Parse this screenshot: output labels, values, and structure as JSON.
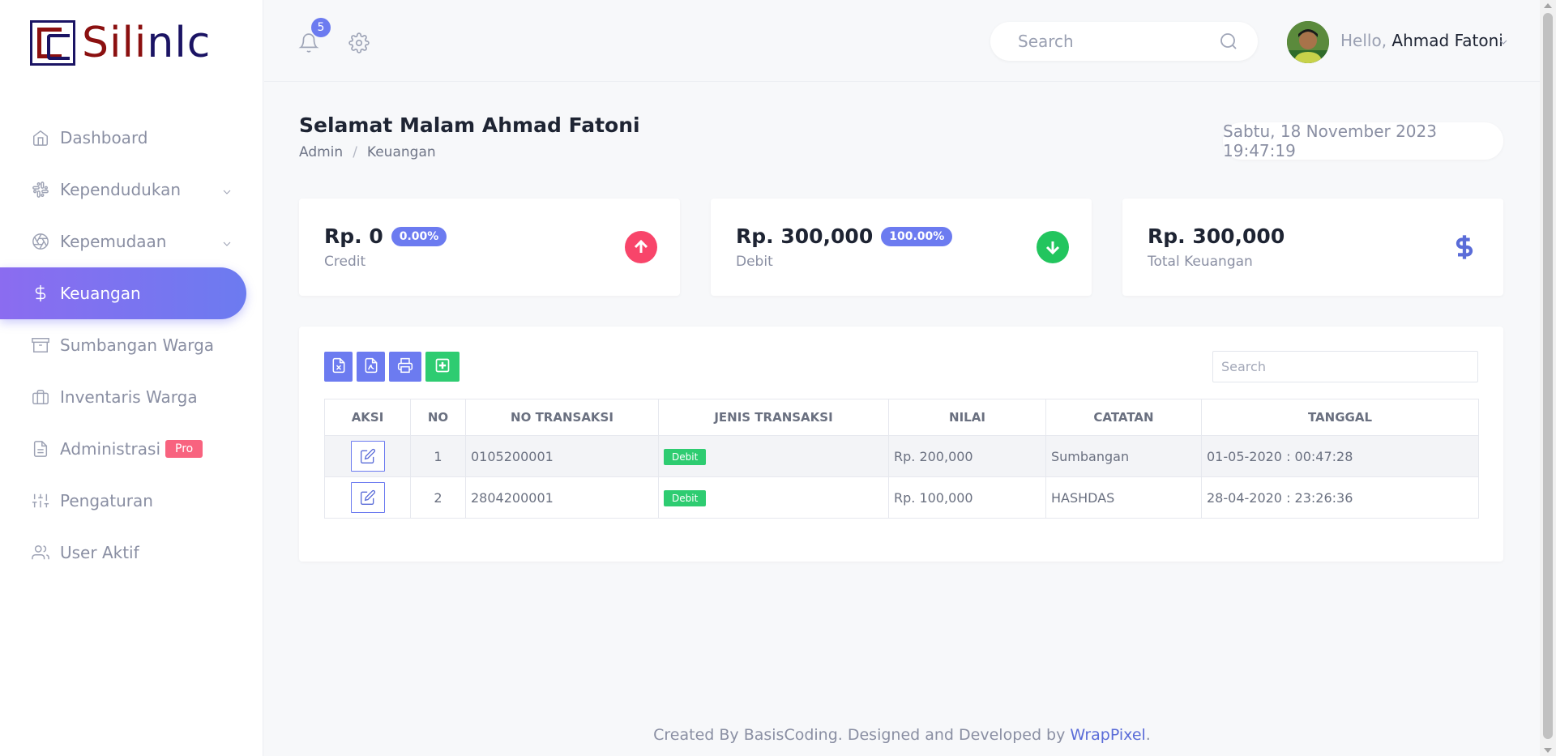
{
  "brand": {
    "logo_text_part1": "Sili",
    "logo_text_part2": "nlc",
    "color_red": "#8b1010",
    "color_navy": "#1b1464"
  },
  "sidebar": {
    "items": [
      {
        "label": "Dashboard",
        "icon": "home-icon"
      },
      {
        "label": "Kependudukan",
        "icon": "slack-icon",
        "has_submenu": true
      },
      {
        "label": "Kepemudaan",
        "icon": "aperture-icon",
        "has_submenu": true
      },
      {
        "label": "Keuangan",
        "icon": "dollar-icon",
        "active": true
      },
      {
        "label": "Sumbangan Warga",
        "icon": "archive-icon"
      },
      {
        "label": "Inventaris Warga",
        "icon": "briefcase-icon"
      },
      {
        "label": "Administrasi",
        "icon": "file-text-icon",
        "badge": "Pro"
      },
      {
        "label": "Pengaturan",
        "icon": "sliders-icon"
      },
      {
        "label": "User Aktif",
        "icon": "users-icon"
      }
    ]
  },
  "topbar": {
    "notification_count": "5",
    "search_placeholder": "Search",
    "greeting": "Hello,",
    "user_name": "Ahmad Fatoni"
  },
  "page": {
    "title": "Selamat Malam Ahmad Fatoni",
    "breadcrumb": [
      "Admin",
      "Keuangan"
    ],
    "datetime": "Sabtu, 18 November 2023 19:47:19"
  },
  "cards": [
    {
      "amount": "Rp. 0",
      "percent": "0.00%",
      "label": "Credit",
      "icon": "arrow-up-circle-icon",
      "icon_color": "#f8456a"
    },
    {
      "amount": "Rp. 300,000",
      "percent": "100.00%",
      "label": "Debit",
      "icon": "arrow-down-circle-icon",
      "icon_color": "#22c55e"
    },
    {
      "amount": "Rp. 300,000",
      "label": "Total Keuangan",
      "icon": "dollar-icon",
      "icon_color": "#5a6cd8"
    }
  ],
  "table": {
    "search_placeholder": "Search",
    "toolbar": [
      "excel-export-icon",
      "pdf-export-icon",
      "print-icon",
      "add-icon"
    ],
    "headers": [
      "AKSI",
      "NO",
      "NO TRANSAKSI",
      "JENIS TRANSAKSI",
      "NILAI",
      "CATATAN",
      "TANGGAL"
    ],
    "rows": [
      {
        "no": "1",
        "no_transaksi": "0105200001",
        "jenis": "Debit",
        "nilai": "Rp. 200,000",
        "catatan": "Sumbangan",
        "tanggal": "01-05-2020 : 00:47:28"
      },
      {
        "no": "2",
        "no_transaksi": "2804200001",
        "jenis": "Debit",
        "nilai": "Rp. 100,000",
        "catatan": "HASHDAS",
        "tanggal": "28-04-2020 : 23:26:36"
      }
    ]
  },
  "footer": {
    "text": "Created By BasisCoding. Designed and Developed by ",
    "link": "WrapPixel",
    "end": "."
  },
  "colors": {
    "accent": "#6c7bf0",
    "accent_gradient_start": "#8b6cf0",
    "debit_green": "#2ecc71",
    "pro_pink": "#f8637f"
  }
}
